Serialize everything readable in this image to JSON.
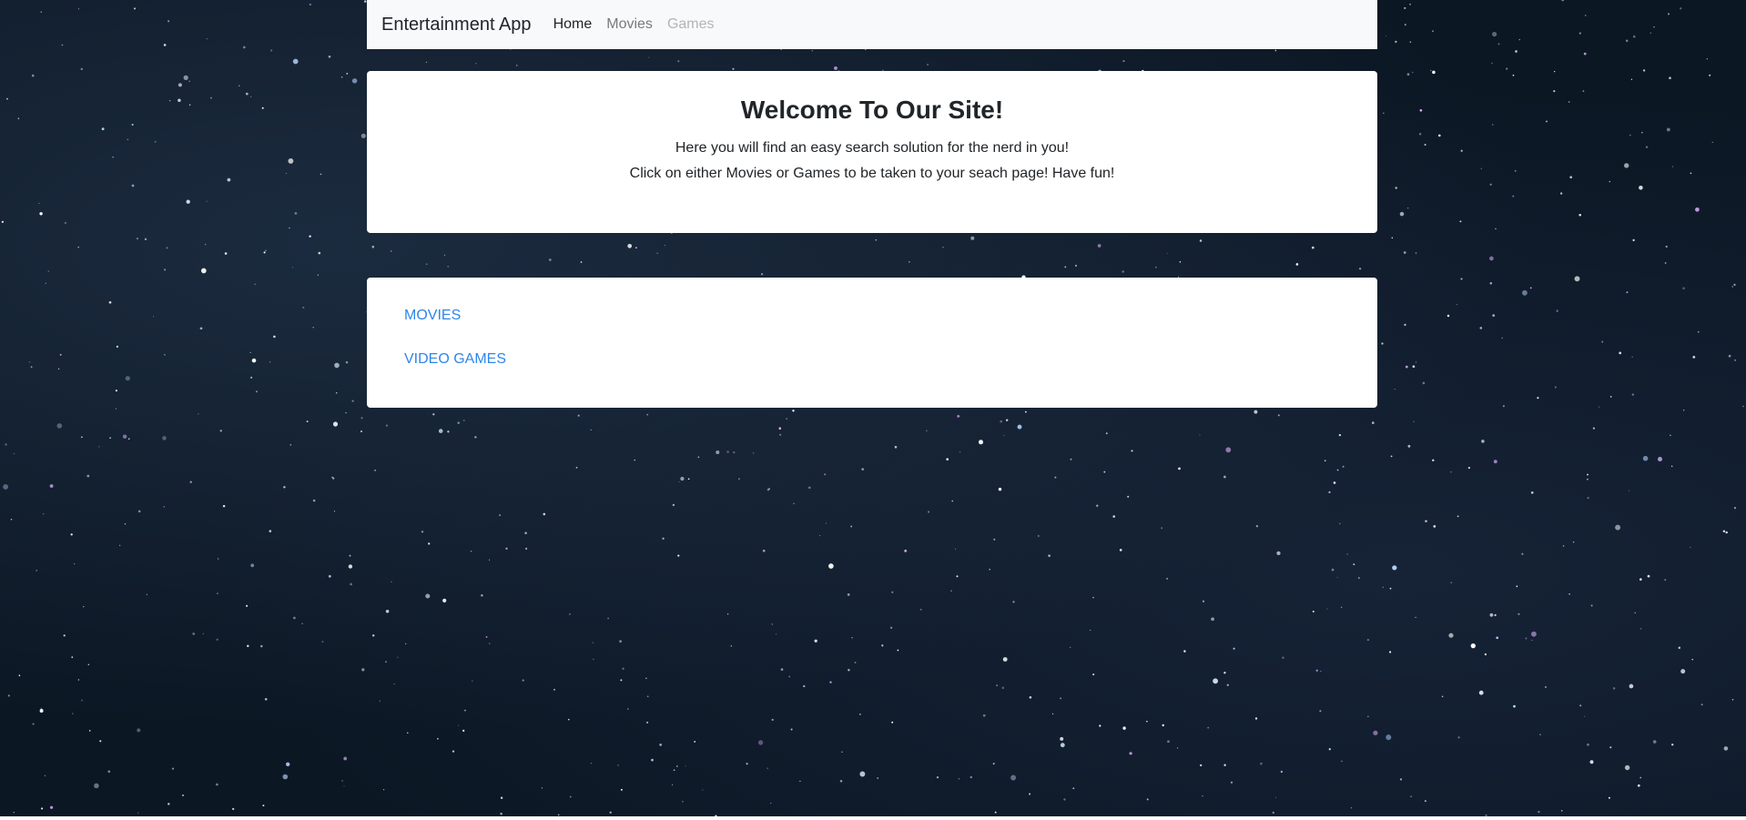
{
  "navbar": {
    "brand": "Entertainment App",
    "links": [
      {
        "label": "Home"
      },
      {
        "label": "Movies"
      },
      {
        "label": "Games"
      }
    ]
  },
  "welcome": {
    "heading": "Welcome To Our Site!",
    "line1": "Here you will find an easy search solution for the nerd in you!",
    "line2": "Click on either Movies or Games to be taken to your seach page! Have fun!"
  },
  "quick_links": [
    {
      "label": "MOVIES"
    },
    {
      "label": "VIDEO GAMES"
    }
  ],
  "colors": {
    "background": "#0c1724",
    "navbar": "#f8f9fa",
    "link": "#2f86e8",
    "text": "#212529"
  }
}
